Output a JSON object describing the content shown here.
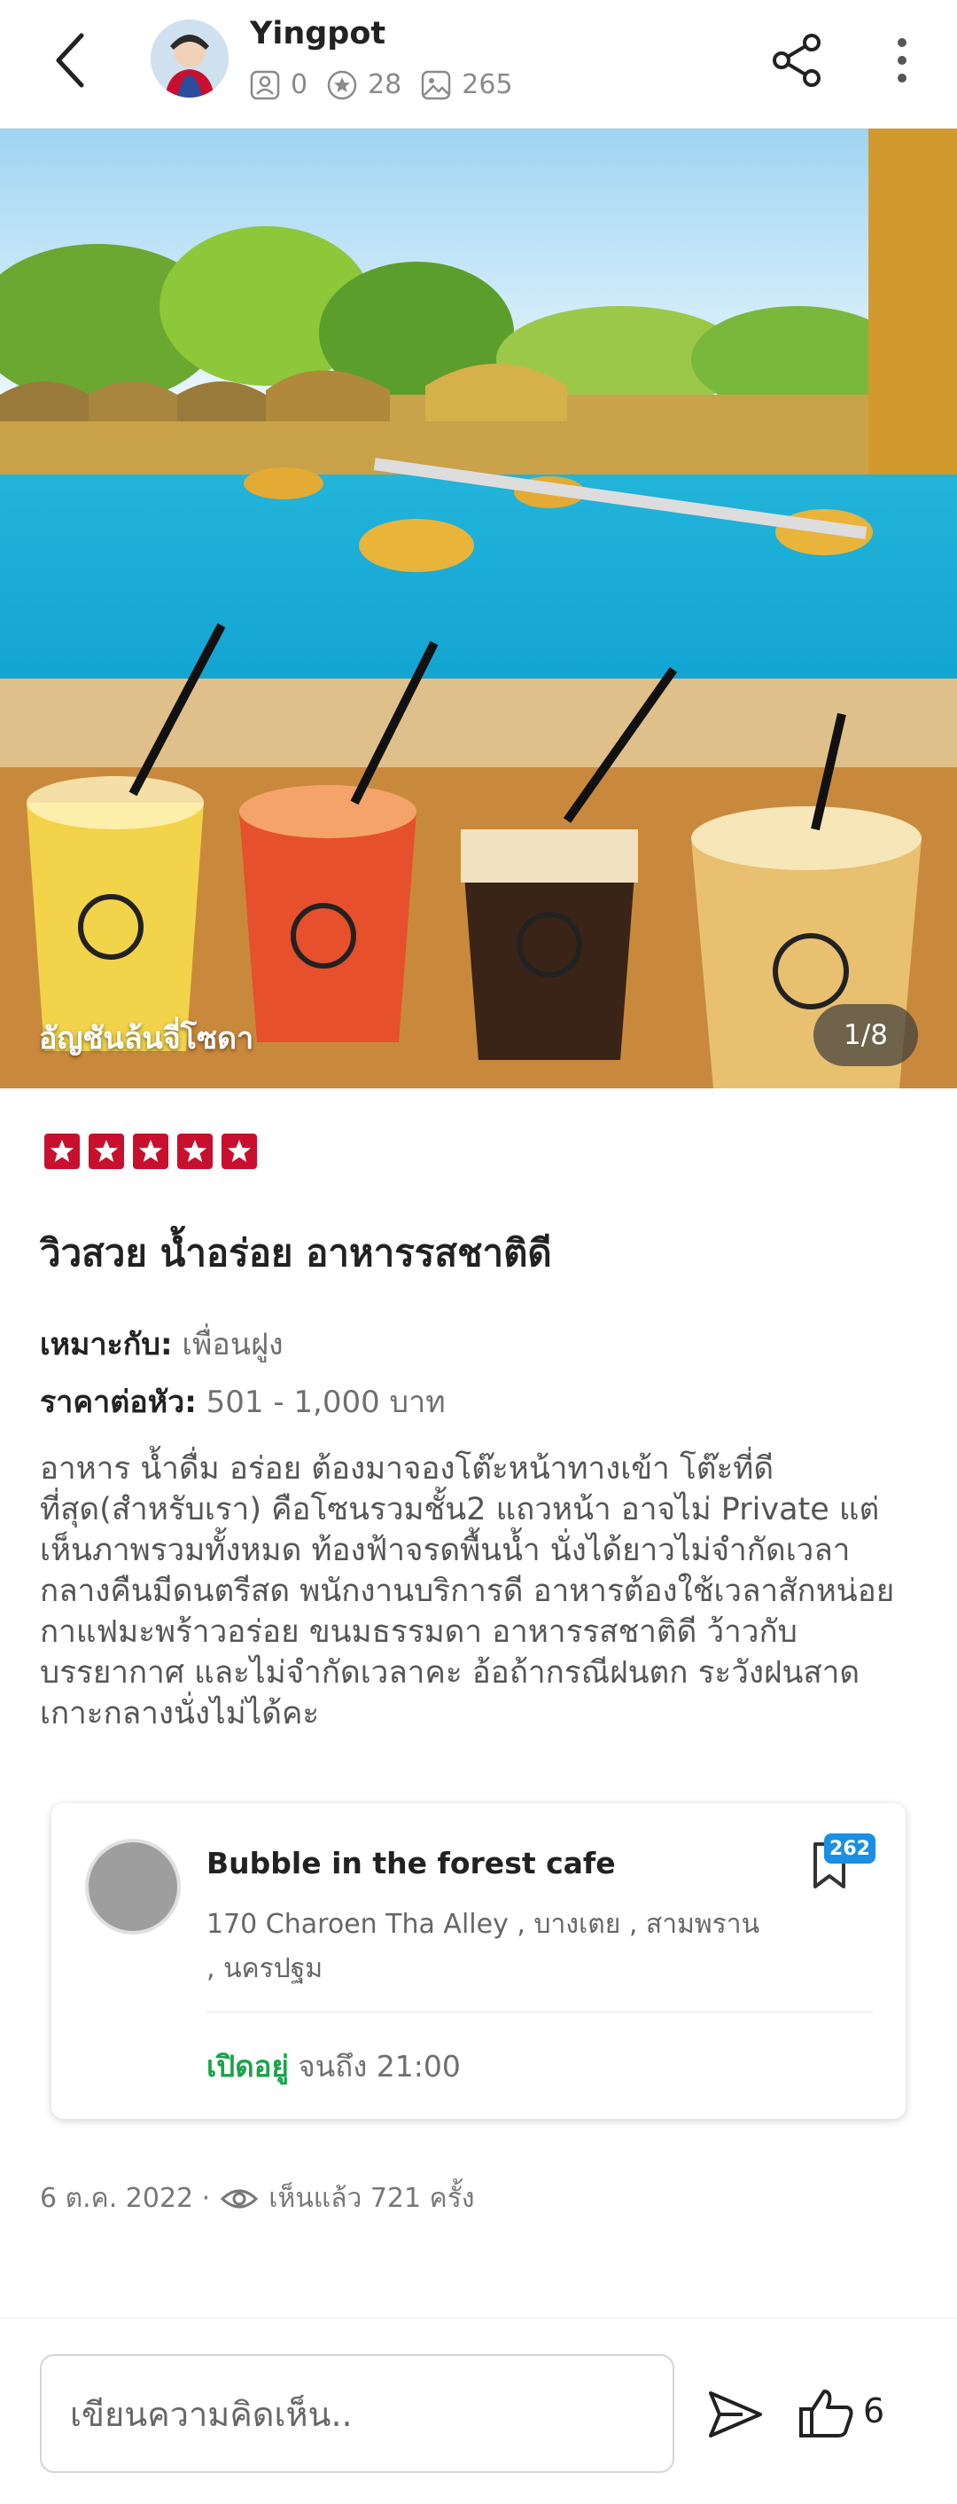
{
  "header": {
    "username": "Yingpot",
    "stats": {
      "followers": "0",
      "reviews": "28",
      "photos": "265"
    }
  },
  "photo": {
    "caption": "อัญชันล้นจี่โซดา",
    "counter": "1/8"
  },
  "review": {
    "rating": 5,
    "title": "วิวสวย น้ำอร่อย อาหารรสชาติดี",
    "suitable_label": "เหมาะกับ:",
    "suitable_value": "เพื่อนฝูง",
    "price_label": "ราคาต่อหัว:",
    "price_value": "501 - 1,000 บาท",
    "description": "อาหาร น้ำดื่ม อร่อย ต้องมาจองโต๊ะหน้าทางเข้า โต๊ะที่ดีที่สุด(สำหรับเรา) คือโซนรวมชั้น2 แถวหน้า อาจไม่ Private แต่เห็นภาพรวมทั้งหมด ท้องฟ้าจรดพื้นน้ำ นั่งได้ยาวไม่จำกัดเวลา กลางคืนมีดนตรีสด พนักงานบริการดี อาหารต้องใช้เวลาสักหน่อย กาแฟมะพร้าวอร่อย ขนมธรรมดา อาหารรสชาติดี ว้าวกับบรรยากาศ และไม่จำกัดเวลาคะ อ้อถ้ากรณีฝนตก ระวังฝนสาด เกาะกลางนั่งไม่ได้คะ"
  },
  "shop": {
    "name": "Bubble in the forest cafe",
    "address": "170 Charoen Tha Alley , บางเตย , สามพราน , นครปฐม",
    "bookmark_count": "262",
    "open_status": "เปิดอยู่",
    "open_hours": "จนถึง 21:00"
  },
  "footer": {
    "date": "6 ต.ค. 2022 ·",
    "views": "เห็นแล้ว 721 ครั้ง"
  },
  "comment_bar": {
    "placeholder": "เขียนความคิดเห็น..",
    "like_count": "6"
  },
  "colors": {
    "star": "#c8102e",
    "open": "#1aa34a",
    "badge": "#1a8fe3"
  }
}
